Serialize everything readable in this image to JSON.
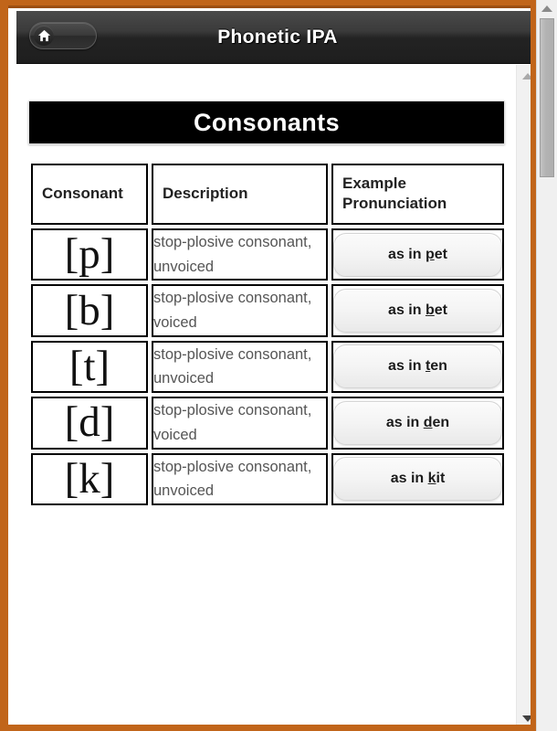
{
  "window": {
    "title": "Phonetic IPA",
    "home_button_icon": "home-icon",
    "frame_color": "#c1651a"
  },
  "section": {
    "banner_title": "Consonants"
  },
  "table": {
    "headers": [
      "Consonant",
      "Description",
      "Example Pronunciation"
    ],
    "rows": [
      {
        "symbol": "[p]",
        "description": "stop-plosive consonant, unvoiced",
        "example_prefix": "as in ",
        "example_underlined": "p",
        "example_suffix": "et"
      },
      {
        "symbol": "[b]",
        "description": "stop-plosive consonant, voiced",
        "example_prefix": "as in ",
        "example_underlined": "b",
        "example_suffix": "et"
      },
      {
        "symbol": "[t]",
        "description": "stop-plosive consonant, unvoiced",
        "example_prefix": "as in ",
        "example_underlined": "t",
        "example_suffix": "en"
      },
      {
        "symbol": "[d]",
        "description": "stop-plosive consonant, voiced",
        "example_prefix": "as in ",
        "example_underlined": "d",
        "example_suffix": "en"
      },
      {
        "symbol": "[k]",
        "description": "stop-plosive consonant, unvoiced",
        "example_prefix": "as in ",
        "example_underlined": "k",
        "example_suffix": "it"
      }
    ]
  },
  "scrollbars": {
    "inner_up_icon": "triangle-up-icon",
    "inner_down_icon": "triangle-down-icon",
    "outer_up_icon": "triangle-up-icon"
  }
}
